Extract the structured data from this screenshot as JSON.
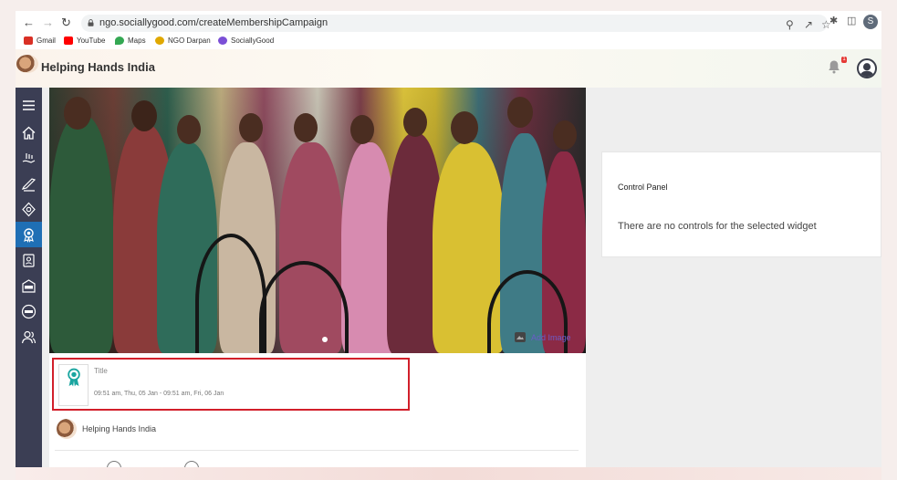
{
  "browser": {
    "url": "ngo.sociallygood.com/createMembershipCampaign",
    "profile_initial": "S",
    "bookmarks": [
      {
        "label": "Gmail",
        "color": "#d93025"
      },
      {
        "label": "YouTube",
        "color": "#ff0000"
      },
      {
        "label": "Maps",
        "color": "#34a853"
      },
      {
        "label": "NGO Darpan",
        "color": "#e0a800"
      },
      {
        "label": "SociallyGood",
        "color": "#7b4fd6"
      }
    ]
  },
  "app": {
    "org_name": "Helping Hands India",
    "notification_count": "1"
  },
  "sidebar": {
    "items": [
      {
        "icon": "menu-icon"
      },
      {
        "icon": "home-icon"
      },
      {
        "icon": "donation-icon"
      },
      {
        "icon": "campaign-icon"
      },
      {
        "icon": "badge-icon"
      },
      {
        "icon": "membership-icon",
        "active": true
      },
      {
        "icon": "volunteer-icon"
      },
      {
        "icon": "ngo-icon"
      },
      {
        "icon": "csr-icon"
      },
      {
        "icon": "users-icon"
      }
    ]
  },
  "widget": {
    "add_image_label": "Add Image",
    "title_placeholder": "Title",
    "date_range": "09:51 am, Thu, 05 Jan - 09:51 am, Fri, 06 Jan",
    "org_name": "Helping Hands India"
  },
  "control_panel": {
    "title": "Control Panel",
    "message": "There are no controls for the selected widget"
  },
  "colors": {
    "sidebar_bg": "#3b3e54",
    "active": "#1f6fb5",
    "accent": "#6b5cc8",
    "highlight_border": "#d21f2a"
  }
}
